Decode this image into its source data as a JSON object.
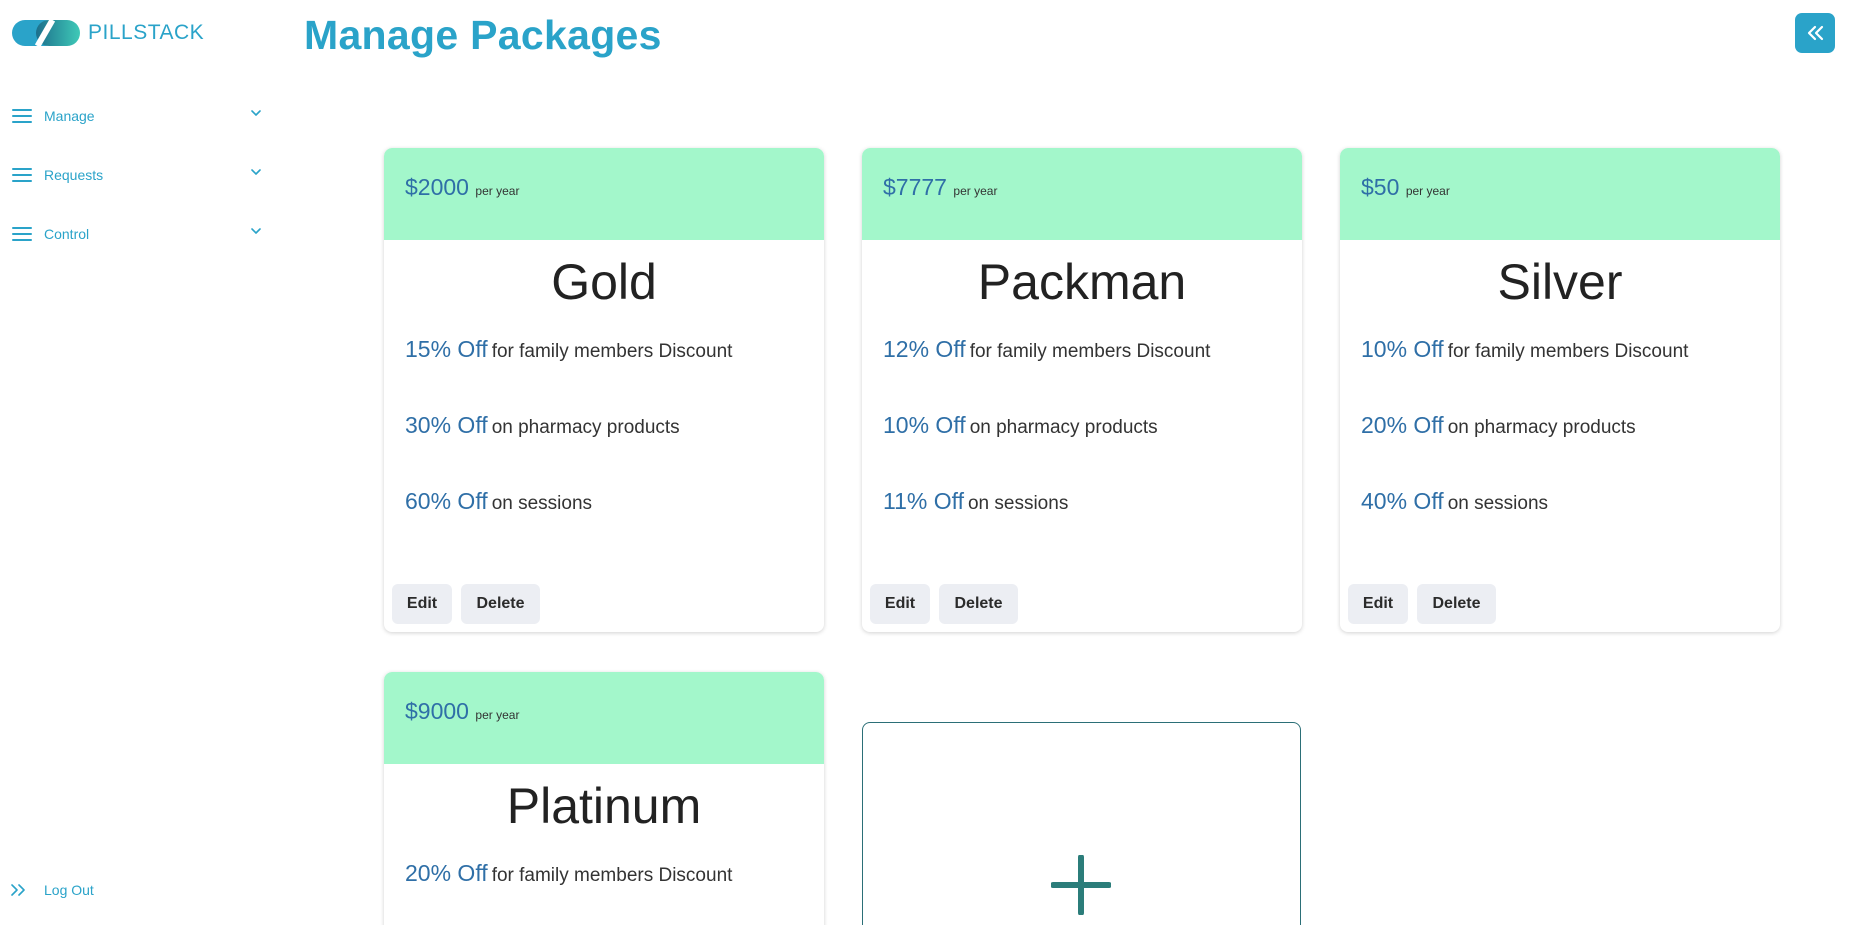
{
  "brand": {
    "name": "PILLSTACK"
  },
  "sidebar": {
    "items": [
      {
        "label": "Manage"
      },
      {
        "label": "Requests"
      },
      {
        "label": "Control"
      }
    ],
    "logout_label": "Log Out"
  },
  "header": {
    "title": "Manage Packages"
  },
  "packages": [
    {
      "price": "$2000",
      "period": "per year",
      "name": "Gold",
      "features": [
        {
          "pct": "15% Off",
          "text": "for family members Discount"
        },
        {
          "pct": "30% Off",
          "text": "on pharmacy products"
        },
        {
          "pct": "60% Off",
          "text": "on sessions"
        }
      ],
      "edit_label": "Edit",
      "delete_label": "Delete"
    },
    {
      "price": "$7777",
      "period": "per year",
      "name": "Packman",
      "features": [
        {
          "pct": "12% Off",
          "text": "for family members Discount"
        },
        {
          "pct": "10% Off",
          "text": "on pharmacy products"
        },
        {
          "pct": "11% Off",
          "text": "on sessions"
        }
      ],
      "edit_label": "Edit",
      "delete_label": "Delete"
    },
    {
      "price": "$50",
      "period": "per year",
      "name": "Silver",
      "features": [
        {
          "pct": "10% Off",
          "text": "for family members Discount"
        },
        {
          "pct": "20% Off",
          "text": "on pharmacy products"
        },
        {
          "pct": "40% Off",
          "text": "on sessions"
        }
      ],
      "edit_label": "Edit",
      "delete_label": "Delete"
    },
    {
      "price": "$9000",
      "period": "per year",
      "name": "Platinum",
      "features": [
        {
          "pct": "20% Off",
          "text": "for family members Discount"
        }
      ]
    }
  ],
  "colors": {
    "accent": "#2aa3c9",
    "card_header": "#a3f7cb",
    "price_text": "#2f6fa7",
    "add_button": "#2b7d7a"
  },
  "icons": {
    "logo": "pillstack-logo-icon",
    "menu": "hamburger-icon",
    "expand": "chevron-down-icon",
    "collapse": "double-chevron-left-icon",
    "logout": "double-chevron-right-icon",
    "add": "plus-icon"
  }
}
